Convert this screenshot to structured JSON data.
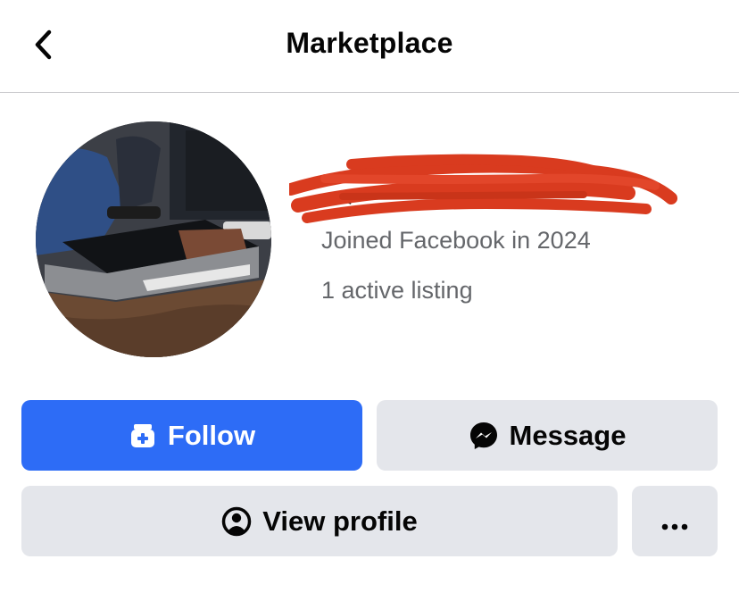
{
  "header": {
    "title": "Marketplace",
    "back_icon": "chevron-left-icon"
  },
  "profile": {
    "avatar_alt": "seller-avatar-photo",
    "name": "",
    "name_redacted": true,
    "joined": "Joined Facebook in 2024",
    "listings": "1 active listing"
  },
  "actions": {
    "follow_label": "Follow",
    "follow_icon": "store-plus-icon",
    "message_label": "Message",
    "message_icon": "messenger-icon",
    "view_profile_label": "View profile",
    "view_profile_icon": "user-circle-icon",
    "more_label": "···",
    "more_icon": "more-horizontal-icon"
  },
  "colors": {
    "primary": "#2d6cf6",
    "secondary_bg": "#e4e6eb",
    "text_primary": "#050505",
    "text_secondary": "#65676b",
    "redaction": "#d93b1f"
  }
}
